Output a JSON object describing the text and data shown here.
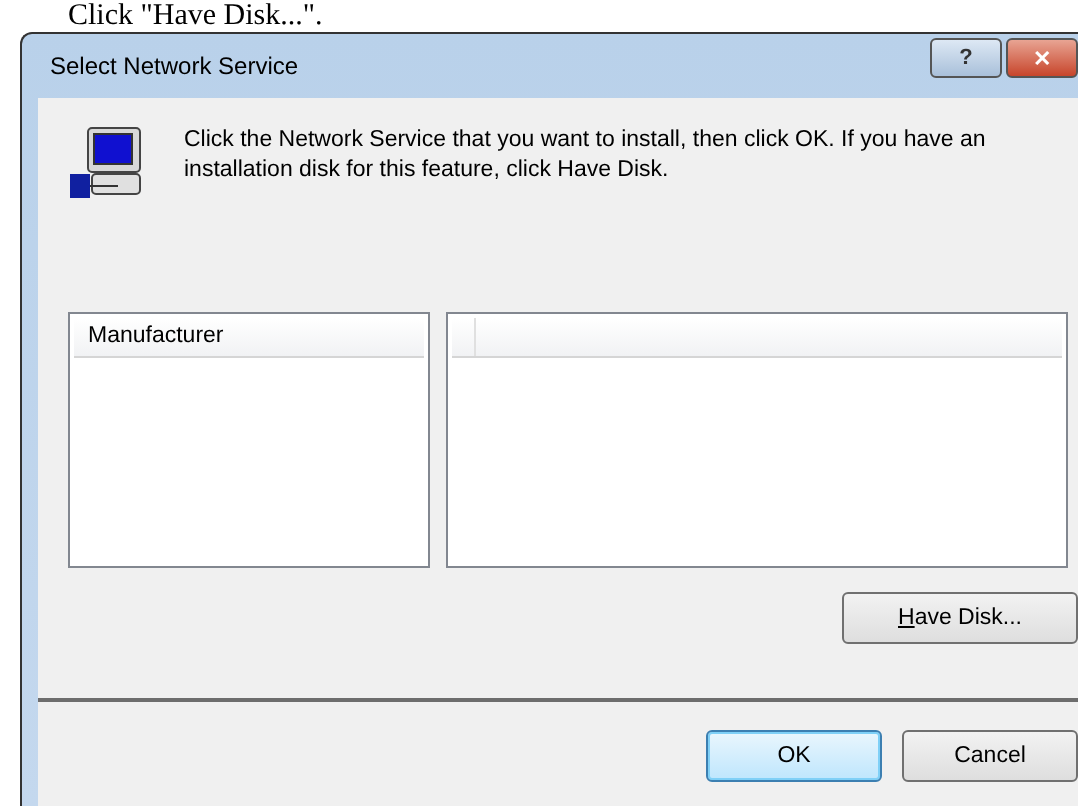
{
  "caption": "Click \"Have Disk...\".",
  "window": {
    "title": "Select Network Service",
    "controls": [
      {
        "kind": "help",
        "label": "?"
      },
      {
        "kind": "close",
        "label": "✕"
      }
    ]
  },
  "instruction": "Click the Network Service that you want to install, then click OK. If you have an installation disk for this feature, click Have Disk.",
  "manufacturer_list": {
    "columns": [
      "Manufacturer"
    ]
  },
  "have_disk_button": {
    "label": "Have Disk...",
    "underline_first": true
  },
  "buttons": [
    {
      "label": "OK",
      "default": true
    },
    {
      "label": "Cancel",
      "default": false
    }
  ]
}
